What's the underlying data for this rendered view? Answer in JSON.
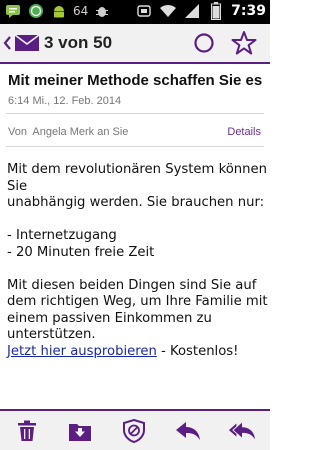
{
  "status_bar": {
    "icons_left": [
      "sms-icon",
      "whatsapp-icon",
      "android-icon",
      "num-64-badge",
      "debug-icon"
    ],
    "badge_number": "64",
    "icons_right": [
      "sim-icon",
      "wifi-icon",
      "signal-icon",
      "battery-icon"
    ],
    "time": "7:39"
  },
  "action_bar": {
    "title": "3 von 50",
    "accent": "#5b1f84"
  },
  "message": {
    "subject": "Mit meiner Methode schaffen Sie es",
    "date": "6:14 Mi., 12. Feb. 2014",
    "from_label": "Von",
    "from_name": "Angela Merk an Sie",
    "details_label": "Details",
    "body": {
      "line1": "Mit dem revolutionären System können Sie",
      "line2": "unabhängig werden. Sie brauchen nur:",
      "bullet1": "- Internetzugang",
      "bullet2": "- 20 Minuten freie Zeit",
      "para2": "Mit diesen beiden Dingen sind Sie auf dem richtigen Weg, um Ihre Familie mit einem passiven Einkommen zu unterstützen.",
      "link_text": "Jetzt hier ausprobieren",
      "link_suffix": " - Kostenlos!"
    }
  },
  "bottom_bar": {
    "items": [
      "delete-icon",
      "move-to-folder-icon",
      "spam-icon",
      "reply-icon",
      "reply-all-icon"
    ]
  }
}
